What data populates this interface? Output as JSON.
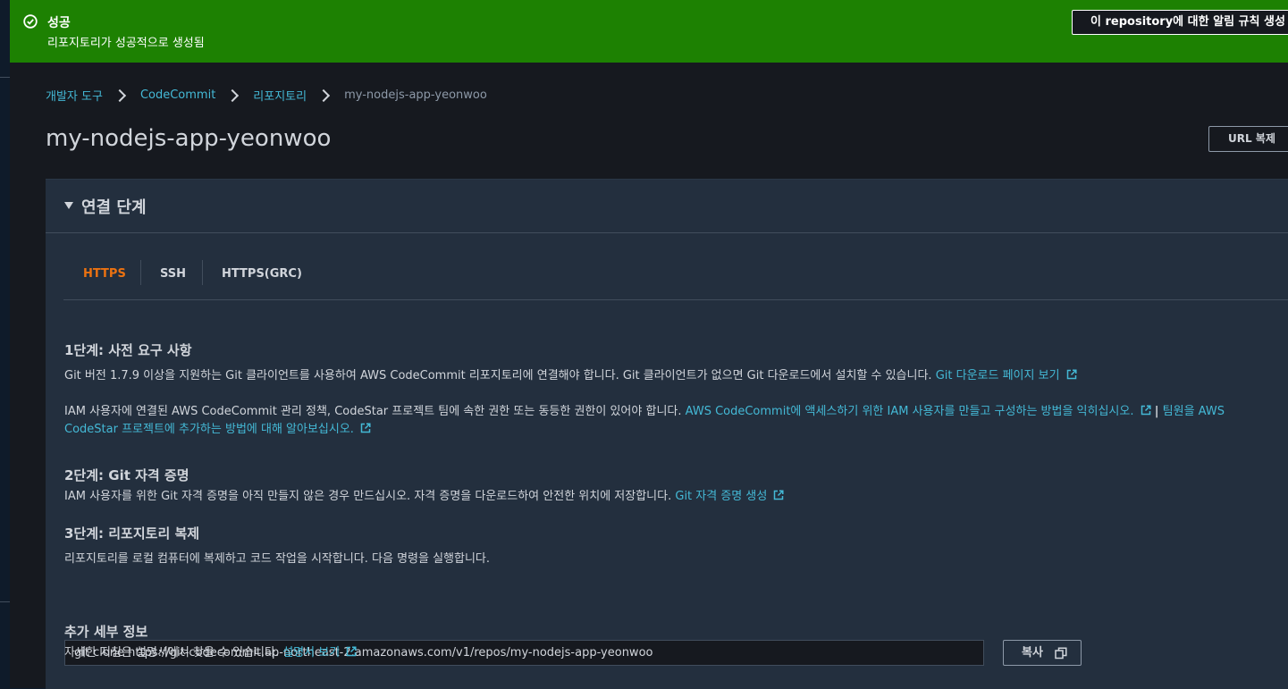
{
  "banner": {
    "title": "성공",
    "message": "리포지토리가 성공적으로 생성됨",
    "action_label": "이 repository에 대한 알림 규칙 생성",
    "icon": "check-circle-icon",
    "color": "#1d8102"
  },
  "breadcrumb": [
    {
      "label": "개발자 도구"
    },
    {
      "label": "CodeCommit"
    },
    {
      "label": "리포지토리"
    },
    {
      "label": "my-nodejs-app-yeonwoo"
    }
  ],
  "page": {
    "title": "my-nodejs-app-yeonwoo",
    "clone_url_button": "URL 복제"
  },
  "panel": {
    "title": "연결 단계",
    "tabs": [
      {
        "label": "HTTPS",
        "active": true
      },
      {
        "label": "SSH",
        "active": false
      },
      {
        "label": "HTTPS(GRC)",
        "active": false
      }
    ],
    "step1": {
      "heading": "1단계: 사전 요구 사항",
      "text1": "Git 버전 1.7.9 이상을 지원하는 Git 클라이언트를 사용하여 AWS CodeCommit 리포지토리에 연결해야 합니다. Git 클라이언트가 없으면 Git 다운로드에서 설치할 수 있습니다.",
      "link1": "Git 다운로드 페이지 보기",
      "text2": "IAM 사용자에 연결된 AWS CodeCommit 관리 정책, CodeStar 프로젝트 팀에 속한 권한 또는 동등한 권한이 있어야 합니다.",
      "link2": "AWS CodeCommit에 액세스하기 위한 IAM 사용자를 만들고 구성하는 방법을 익히십시오.",
      "separator": "|",
      "link3": "팀원을 AWS CodeStar 프로젝트에 추가하는 방법에 대해 알아보십시오."
    },
    "step2": {
      "heading": "2단계: Git 자격 증명",
      "text": "IAM 사용자를 위한 Git 자격 증명을 아직 만들지 않은 경우 만드십시오. 자격 증명을 다운로드하여 안전한 위치에 저장합니다.",
      "link": "Git 자격 증명 생성"
    },
    "step3": {
      "heading": "3단계: 리포지토리 복제",
      "text": "리포지토리를 로컬 컴퓨터에 복제하고 코드 작업을 시작합니다. 다음 명령을 실행합니다.",
      "command": "git clone https://git-codecommit.ap-northeast-2.amazonaws.com/v1/repos/my-nodejs-app-yeonwoo",
      "copy_label": "복사"
    },
    "more": {
      "heading": "추가 세부 정보",
      "text": "자세한 지침은 설명서에서 찾을 수 있습니다.",
      "link": "설명서 보기"
    }
  },
  "colors": {
    "accent_tab": "#ec7211",
    "link": "#44b9d6",
    "panel_bg": "#232f3e",
    "page_bg": "#16191f"
  }
}
